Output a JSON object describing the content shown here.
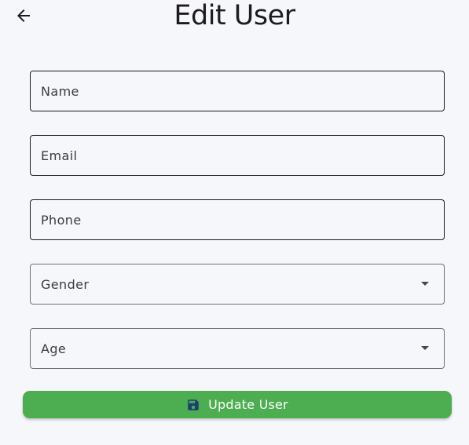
{
  "header": {
    "title": "Edit User",
    "back_icon": "arrow-left-icon"
  },
  "form": {
    "name_label": "Name",
    "email_label": "Email",
    "phone_label": "Phone",
    "gender_label": "Gender",
    "age_label": "Age",
    "dropdown_icon": "dropdown-arrow-icon"
  },
  "actions": {
    "update_label": "Update User",
    "update_icon": "save-icon",
    "update_color": "#4cae50"
  },
  "theme": {
    "background": "#f6f7fb",
    "text": "#1d1b20"
  }
}
